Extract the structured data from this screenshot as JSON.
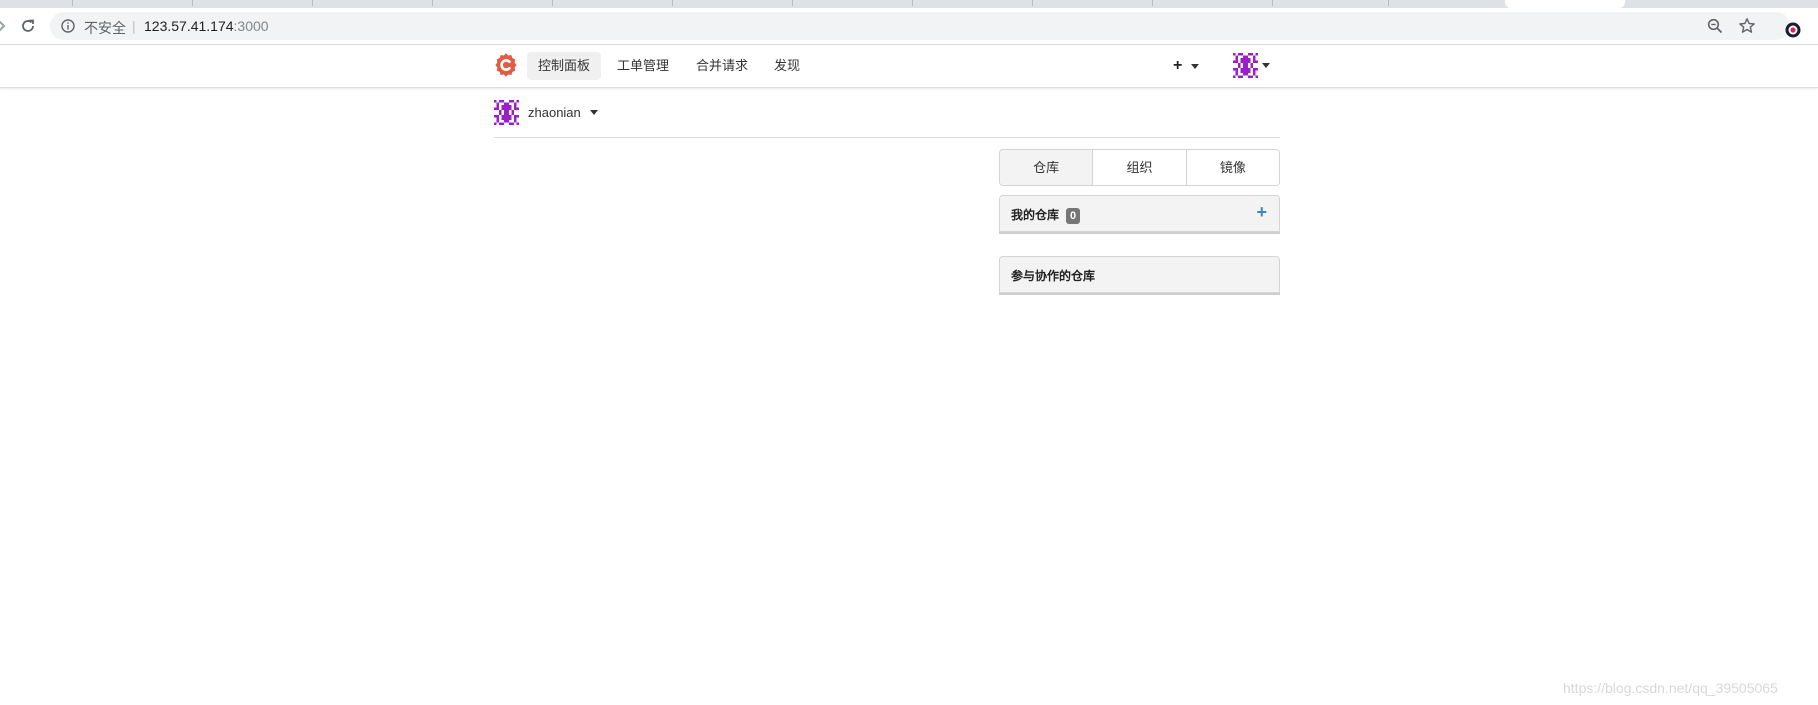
{
  "browser": {
    "security_label": "不安全",
    "url_host": "123.57.41.174",
    "url_port": ":3000"
  },
  "navbar": {
    "items": [
      {
        "label": "控制面板",
        "active": true
      },
      {
        "label": "工单管理",
        "active": false
      },
      {
        "label": "合并请求",
        "active": false
      },
      {
        "label": "发现",
        "active": false
      }
    ],
    "create_label": "+"
  },
  "context": {
    "username": "zhaonian"
  },
  "dashboard": {
    "tabs": [
      {
        "label": "仓库",
        "active": true
      },
      {
        "label": "组织",
        "active": false
      },
      {
        "label": "镜像",
        "active": false
      }
    ],
    "my_repos": {
      "title": "我的仓库",
      "count": "0",
      "add_label": "+"
    },
    "collab_repos": {
      "title": "参与协作的仓库"
    }
  },
  "colors": {
    "brand": "#609926",
    "logo": "#e05d44",
    "avatar": "#9b1fc9",
    "link": "#4183c4"
  },
  "watermark": "https://blog.csdn.net/qq_39505065"
}
